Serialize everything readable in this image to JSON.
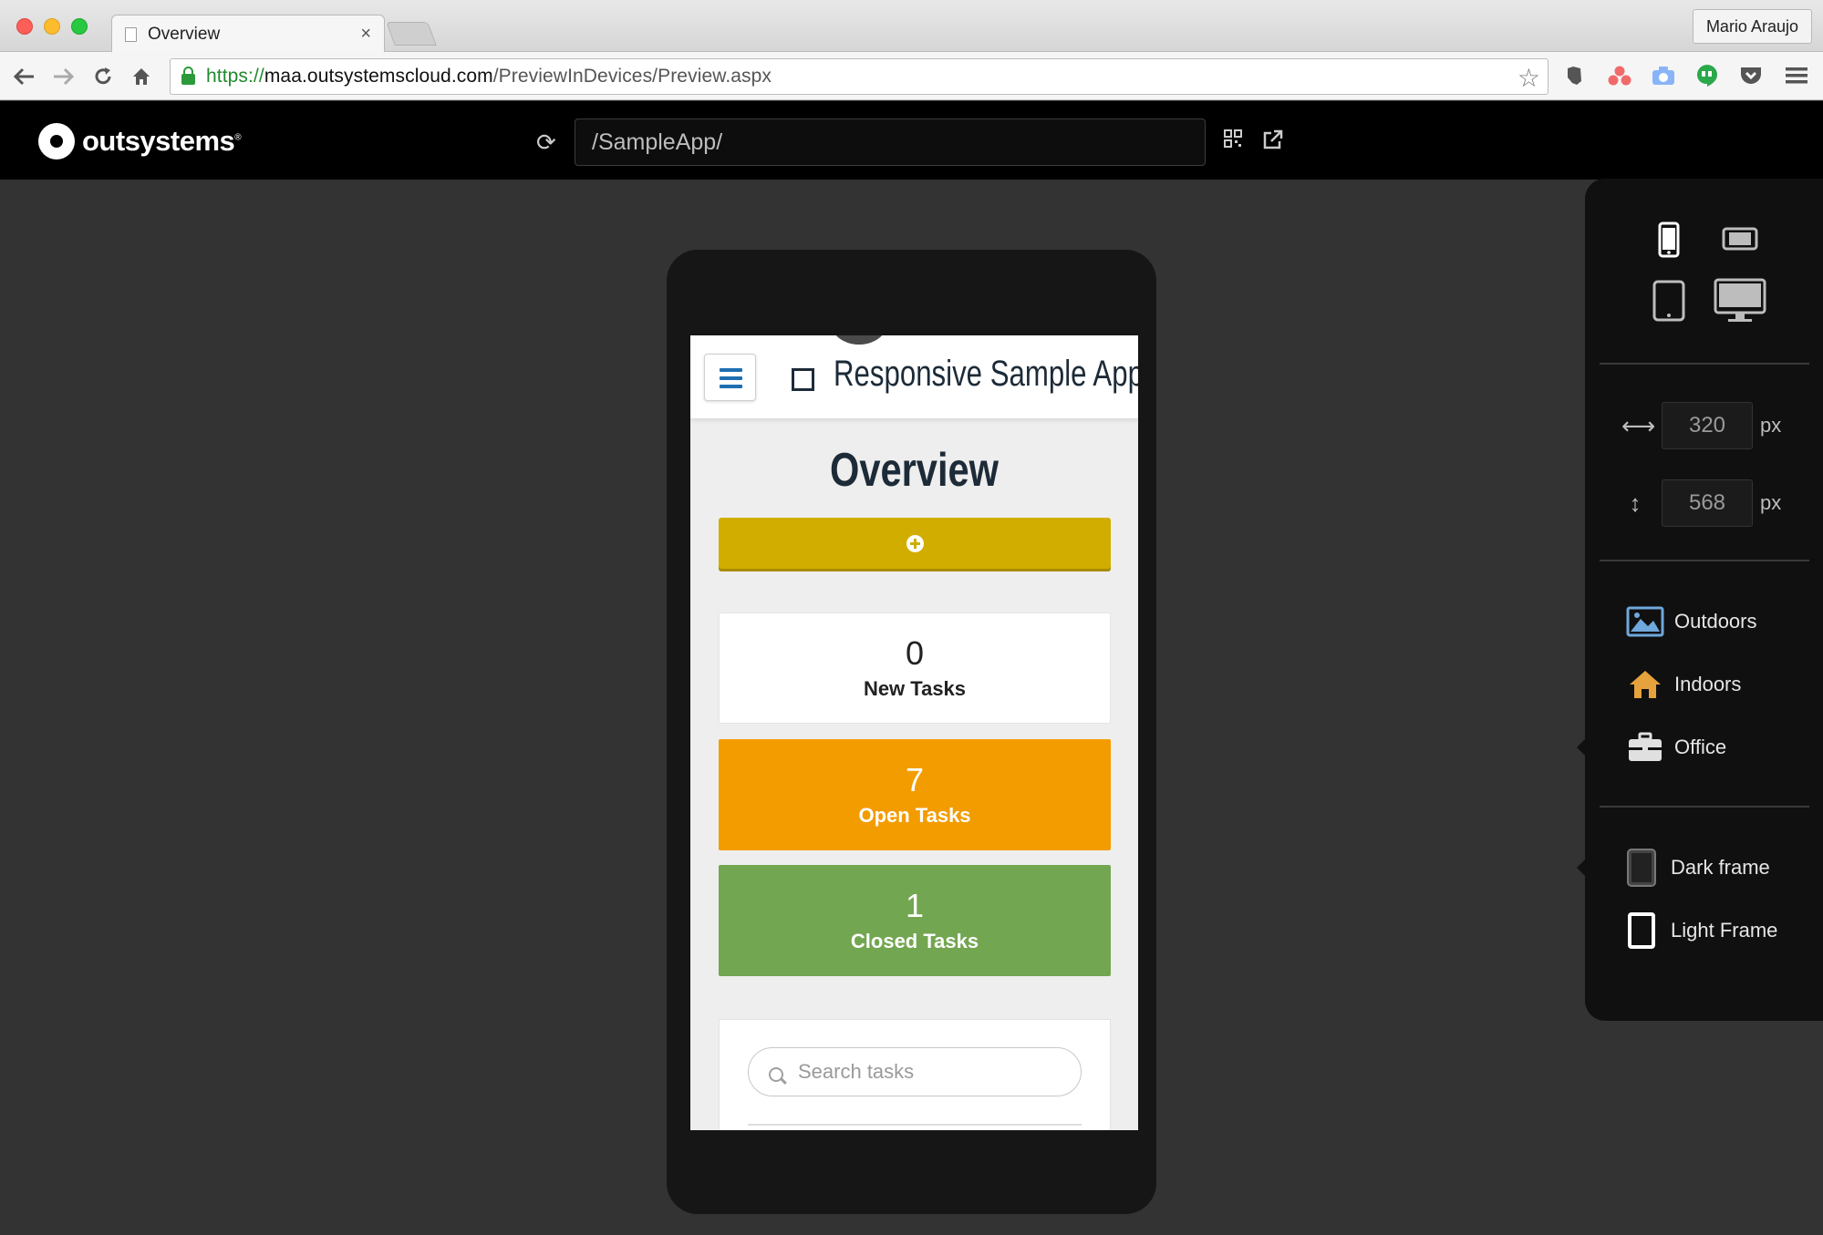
{
  "browser": {
    "tab_title": "Overview",
    "tab_close": "×",
    "profile_name": "Mario Araujo",
    "url_scheme": "https://",
    "url_host": "maa.outsystemscloud.com",
    "url_path": "/PreviewInDevices/Preview.aspx",
    "icons": [
      "back-arrow-icon",
      "forward-arrow-icon",
      "reload-icon",
      "home-icon",
      "lock-icon",
      "bookmark-star-icon",
      "evernote-icon",
      "asana-icon",
      "camera-icon",
      "hangouts-icon",
      "pocket-icon",
      "menu-icon"
    ]
  },
  "preview_header": {
    "logo_text": "outsystems",
    "logo_mark": "®",
    "path": "/SampleApp/"
  },
  "app": {
    "title": "Responsive Sample App",
    "page_title": "Overview",
    "cards": [
      {
        "count": "0",
        "label": "New Tasks"
      },
      {
        "count": "7",
        "label": "Open Tasks"
      },
      {
        "count": "1",
        "label": "Closed Tasks"
      }
    ],
    "search_placeholder": "Search tasks"
  },
  "side_panel": {
    "width_value": "320",
    "height_value": "568",
    "unit": "px",
    "environments": [
      {
        "label": "Outdoors",
        "icon": "landscape-icon"
      },
      {
        "label": "Indoors",
        "icon": "house-icon"
      },
      {
        "label": "Office",
        "icon": "briefcase-icon"
      }
    ],
    "frames": [
      {
        "label": "Dark frame",
        "icon": "dark-frame-icon"
      },
      {
        "label": "Light Frame",
        "icon": "light-frame-icon"
      }
    ]
  },
  "colors": {
    "add_button": "#d1ad00",
    "open_tasks": "#f39c00",
    "closed_tasks": "#73a650",
    "menu_icon": "#1e6fb0",
    "app_text": "#1d2b38"
  }
}
